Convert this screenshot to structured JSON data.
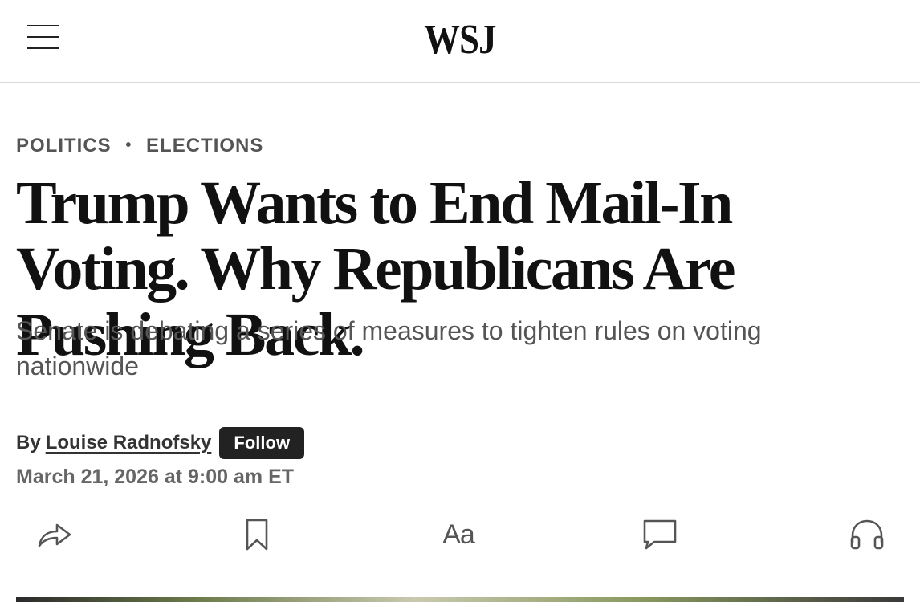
{
  "header": {
    "logo": "WSJ",
    "menu_icon": "hamburger-menu-icon"
  },
  "article": {
    "kicker": {
      "section": "POLITICS",
      "separator": "•",
      "subsection": "ELECTIONS"
    },
    "headline": "Trump Wants to End Mail-In Voting. Why Republicans Are Pushing Back.",
    "dek": "Senate is debating a series of measures to tighten rules on voting nationwide",
    "byline": {
      "prefix": "By",
      "author": "Louise Radnofsky",
      "follow_label": "Follow"
    },
    "timestamp": "March 21, 2026 at 9:00 am ET"
  },
  "toolbar": {
    "items": [
      {
        "icon": "share-icon"
      },
      {
        "icon": "bookmark-icon"
      },
      {
        "icon": "text-size-icon",
        "label": "Aa"
      },
      {
        "icon": "comment-icon"
      },
      {
        "icon": "headphones-icon"
      }
    ]
  },
  "colors": {
    "text": "#111111",
    "muted": "#555555",
    "button_bg": "#222222",
    "divider": "#d9d9d9"
  }
}
